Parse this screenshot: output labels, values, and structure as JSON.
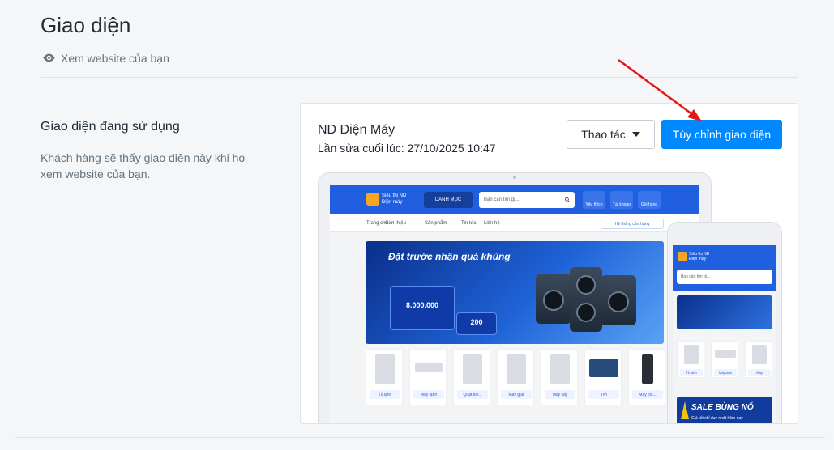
{
  "header": {
    "title": "Giao diện",
    "view_link": "Xem website của bạn"
  },
  "section": {
    "title": "Giao diện đang sử dụng",
    "description": "Khách hàng sẽ thấy giao diện này khi họ xem website của bạn."
  },
  "theme": {
    "name": "ND Điện Máy",
    "last_edited": "Lần sửa cuối lúc: 27/10/2025 10:47",
    "actions_label": "Thao tác",
    "customize_label": "Tùy chỉnh giao diện"
  },
  "preview": {
    "logo_line1": "Siêu thị ND",
    "logo_line2": "Điện máy",
    "category_button": "DANH MỤC",
    "search_placeholder": "Bạn cần tìm gì...",
    "header_icons": [
      "Yêu thích",
      "Tài khoản",
      "Giỏ hàng"
    ],
    "nav": [
      "Trang chủ",
      "Giới thiệu",
      "Sản phẩm",
      "Tin tức",
      "Liên hệ"
    ],
    "store_system": "Hệ thống cửa hàng",
    "banner_title": "Đặt trước nhận quà khủng",
    "banner_price_big": "8.000.000",
    "banner_price_small": "200",
    "products": [
      "Tủ lạnh",
      "Máy lạnh",
      "Quạt điề...",
      "Máy giặt",
      "Máy sấy",
      "Tivi",
      "Máy lọc..."
    ],
    "mobile_products": [
      "Tủ lạnh",
      "Máy lạnh",
      "Máy"
    ],
    "sale_title": "SALE BÙNG NỔ",
    "sale_subtitle": "Giá tốt chỉ duy nhất hôm nay"
  },
  "colors": {
    "primary": "#0088ff",
    "site_header": "#1f5fe0",
    "annotation_arrow": "#e0191b"
  }
}
